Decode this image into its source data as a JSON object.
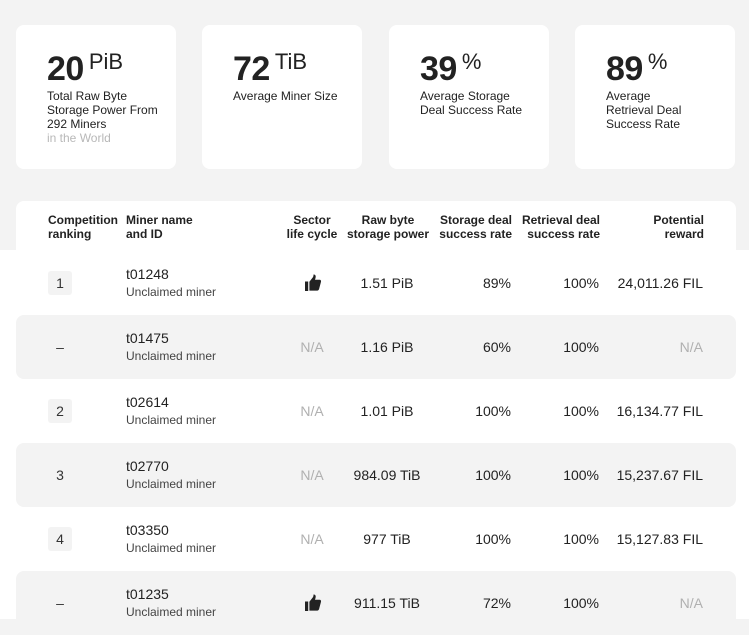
{
  "summary": [
    {
      "value": "20",
      "unit": "PiB",
      "desc": "Total Raw Byte Storage Power From 292 Miners",
      "desc_muted": "in the World"
    },
    {
      "value": "72",
      "unit": "TiB",
      "desc": "Average Miner Size",
      "desc_muted": ""
    },
    {
      "value": "39",
      "unit": "%",
      "desc": "Average Storage Deal Success Rate",
      "desc_muted": ""
    },
    {
      "value": "89",
      "unit": "%",
      "desc": "Average Retrieval Deal Success Rate",
      "desc_muted": ""
    }
  ],
  "columns": {
    "ranking": "Competition ranking",
    "miner": "Miner name and ID",
    "sector": "Sector life cycle",
    "raw": "Raw byte storage power",
    "storage_rate": "Storage deal success rate",
    "retrieval_rate": "Retrieval deal success rate",
    "reward": "Potential reward"
  },
  "rows": [
    {
      "rank": "1",
      "id": "t01248",
      "name": "Unclaimed miner",
      "sector": "thumbs-up-icon",
      "raw": "1.51 PiB",
      "storage_rate": "89%",
      "retrieval_rate": "100%",
      "reward": "24,011.26 FIL"
    },
    {
      "rank": "–",
      "id": "t01475",
      "name": "Unclaimed miner",
      "sector": "N/A",
      "raw": "1.16 PiB",
      "storage_rate": "60%",
      "retrieval_rate": "100%",
      "reward": "N/A"
    },
    {
      "rank": "2",
      "id": "t02614",
      "name": "Unclaimed miner",
      "sector": "N/A",
      "raw": "1.01 PiB",
      "storage_rate": "100%",
      "retrieval_rate": "100%",
      "reward": "16,134.77 FIL"
    },
    {
      "rank": "3",
      "id": "t02770",
      "name": "Unclaimed miner",
      "sector": "N/A",
      "raw": "984.09 TiB",
      "storage_rate": "100%",
      "retrieval_rate": "100%",
      "reward": "15,237.67 FIL"
    },
    {
      "rank": "4",
      "id": "t03350",
      "name": "Unclaimed miner",
      "sector": "N/A",
      "raw": "977 TiB",
      "storage_rate": "100%",
      "retrieval_rate": "100%",
      "reward": "15,127.83 FIL"
    },
    {
      "rank": "–",
      "id": "t01235",
      "name": "Unclaimed miner",
      "sector": "thumbs-up-icon",
      "raw": "911.15 TiB",
      "storage_rate": "72%",
      "retrieval_rate": "100%",
      "reward": "N/A"
    }
  ]
}
